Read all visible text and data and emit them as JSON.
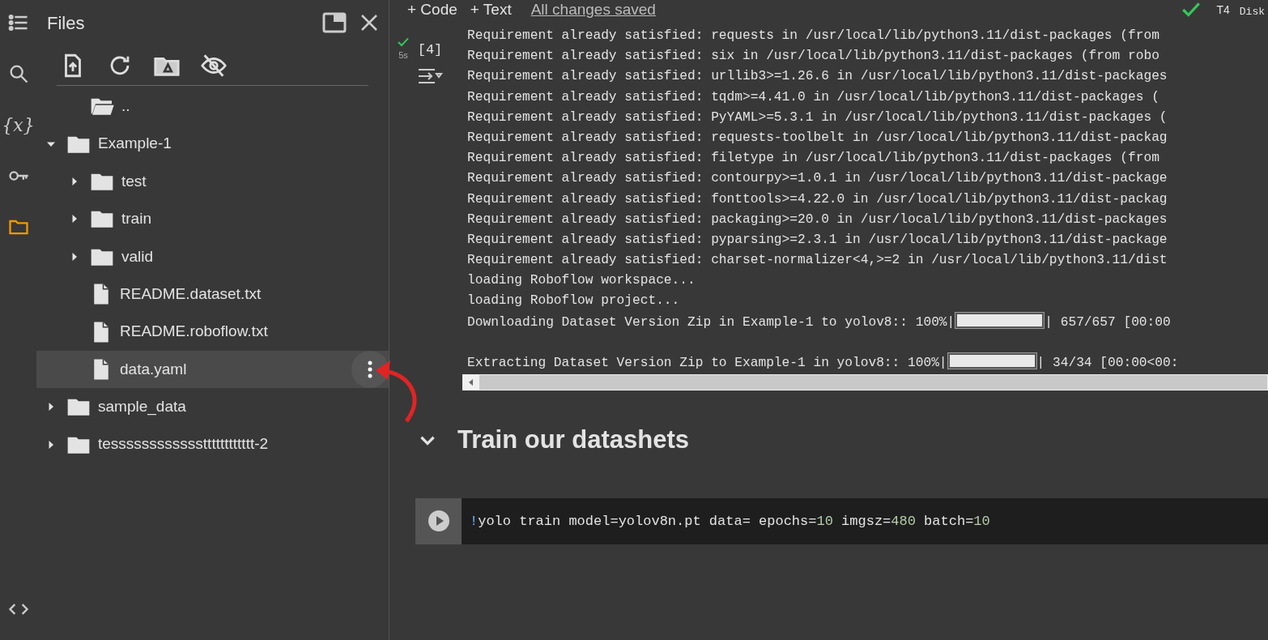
{
  "rail": [
    {
      "kind": "menu",
      "selected": false
    },
    {
      "kind": "search",
      "selected": false
    },
    {
      "kind": "variables",
      "glyph": "{x}",
      "selected": false
    },
    {
      "kind": "key",
      "selected": false
    },
    {
      "kind": "folder",
      "selected": true
    }
  ],
  "rail_bottom": {
    "kind": "code"
  },
  "files_panel": {
    "title": "Files",
    "tree": [
      {
        "name": "..",
        "kind": "parent"
      },
      {
        "name": "Example-1",
        "kind": "folder",
        "expanded": true,
        "children": [
          {
            "name": "test",
            "kind": "folder",
            "expanded": false
          },
          {
            "name": "train",
            "kind": "folder",
            "expanded": false
          },
          {
            "name": "valid",
            "kind": "folder",
            "expanded": false
          },
          {
            "name": "README.dataset.txt",
            "kind": "file",
            "selected": false
          },
          {
            "name": "README.roboflow.txt",
            "kind": "file",
            "selected": false
          },
          {
            "name": "data.yaml",
            "kind": "file",
            "selected": true
          }
        ]
      },
      {
        "name": "sample_data",
        "kind": "folder",
        "expanded": false
      },
      {
        "name": "tesssssssssssstttttttttttt-2",
        "kind": "folder",
        "expanded": false
      }
    ]
  },
  "toolbar": {
    "buttons": [
      {
        "icon": "+",
        "label": "Code"
      },
      {
        "icon": "+",
        "label": "Text"
      }
    ],
    "save_status": "All changes saved",
    "runtime": "T4",
    "disk": "Disk"
  },
  "output_cell": {
    "execution_count": "[4]",
    "duration": "5s",
    "succeeded": true,
    "lines": [
      {
        "text": "Requirement already satisfied: requests in /usr/local/lib/python3.11/dist-packages (from"
      },
      {
        "text": "Requirement already satisfied: six in /usr/local/lib/python3.11/dist-packages (from robo"
      },
      {
        "text": "Requirement already satisfied: urllib3>=1.26.6 in /usr/local/lib/python3.11/dist-packages"
      },
      {
        "text": "Requirement already satisfied: tqdm>=4.41.0 in /usr/local/lib/python3.11/dist-packages ("
      },
      {
        "text": "Requirement already satisfied: PyYAML>=5.3.1 in /usr/local/lib/python3.11/dist-packages ("
      },
      {
        "text": "Requirement already satisfied: requests-toolbelt in /usr/local/lib/python3.11/dist-packag"
      },
      {
        "text": "Requirement already satisfied: filetype in /usr/local/lib/python3.11/dist-packages (from"
      },
      {
        "text": "Requirement already satisfied: contourpy>=1.0.1 in /usr/local/lib/python3.11/dist-package"
      },
      {
        "text": "Requirement already satisfied: fonttools>=4.22.0 in /usr/local/lib/python3.11/dist-packag"
      },
      {
        "text": "Requirement already satisfied: packaging>=20.0 in /usr/local/lib/python3.11/dist-packages"
      },
      {
        "text": "Requirement already satisfied: pyparsing>=2.3.1 in /usr/local/lib/python3.11/dist-package"
      },
      {
        "text": "Requirement already satisfied: charset-normalizer<4,>=2 in /usr/local/lib/python3.11/dist"
      },
      {
        "text": "loading Roboflow workspace..."
      },
      {
        "text": "loading Roboflow project..."
      },
      {
        "text": "Downloading Dataset Version Zip in Example-1 to yolov8:: 100%|",
        "progress": {
          "level": 1,
          "after": "| 657/657 [00:00"
        }
      },
      {
        "kind": "blank"
      },
      {
        "text": "Extracting Dataset Version Zip to Example-1 in yolov8:: 100%|",
        "progress": {
          "level": 1,
          "after": "| 34/34 [00:00<00:"
        }
      }
    ]
  },
  "section": {
    "title": "Train our datashets",
    "expanded": true
  },
  "code_cell": {
    "tokens": [
      {
        "kind": "bang",
        "text": "!"
      },
      {
        "kind": "plain",
        "text": "yolo train model=yolov8n.pt data= epochs="
      },
      {
        "kind": "number",
        "text": "10"
      },
      {
        "kind": "plain",
        "text": " imgsz="
      },
      {
        "kind": "number",
        "text": "480"
      },
      {
        "kind": "plain",
        "text": " batch="
      },
      {
        "kind": "number",
        "text": "10"
      }
    ]
  }
}
